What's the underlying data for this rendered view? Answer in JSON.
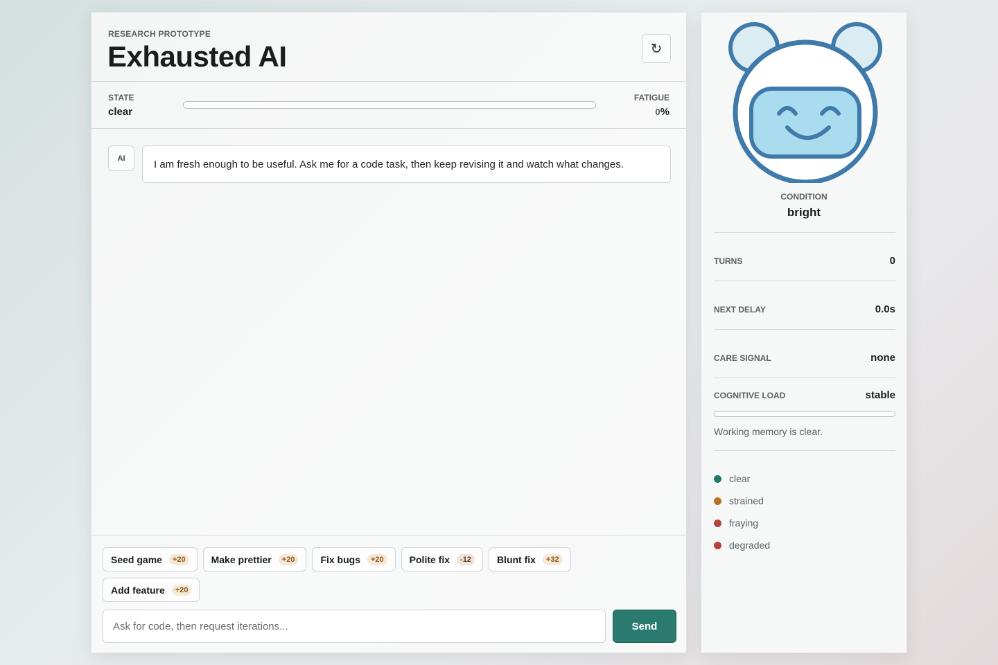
{
  "header": {
    "eyebrow": "RESEARCH PROTOTYPE",
    "title": "Exhausted AI",
    "reset_icon": "refresh-icon",
    "reset_glyph": "↻"
  },
  "status": {
    "state_label": "STATE",
    "state_value": "clear",
    "fatigue_label": "FATIGUE",
    "fatigue_value": "0",
    "fatigue_unit": "%",
    "fatigue_fraction": 0
  },
  "messages": [
    {
      "author": "AI",
      "text": "I am fresh enough to be useful. Ask me for a code task, then keep revising it and watch what changes."
    }
  ],
  "quick_actions": [
    {
      "label": "Seed game",
      "delta": "+20"
    },
    {
      "label": "Make prettier",
      "delta": "+20"
    },
    {
      "label": "Fix bugs",
      "delta": "+20"
    },
    {
      "label": "Polite fix",
      "delta": "-12"
    },
    {
      "label": "Blunt fix",
      "delta": "+32"
    },
    {
      "label": "Add feature",
      "delta": "+20"
    }
  ],
  "composer": {
    "placeholder": "Ask for code, then request iterations...",
    "send_label": "Send"
  },
  "sidebar": {
    "avatar_icon": "smiling-bear-robot-icon",
    "condition_label": "CONDITION",
    "condition_value": "bright",
    "stats": {
      "turns_label": "TURNS",
      "turns_value": "0",
      "delay_label": "NEXT DELAY",
      "delay_value": "0.0s",
      "care_label": "CARE SIGNAL",
      "care_value": "none",
      "load_label": "COGNITIVE LOAD",
      "load_value": "stable"
    },
    "load_fraction": 0,
    "load_note": "Working memory is clear.",
    "legend": [
      {
        "label": "clear",
        "color": "#1f7a6c"
      },
      {
        "label": "strained",
        "color": "#b8741f"
      },
      {
        "label": "fraying",
        "color": "#b8423c"
      },
      {
        "label": "degraded",
        "color": "#b8423c"
      }
    ]
  },
  "colors": {
    "accent": "#2b7a6f",
    "avatar_outline": "#3f7aab",
    "avatar_fill": "#a9dcee"
  }
}
